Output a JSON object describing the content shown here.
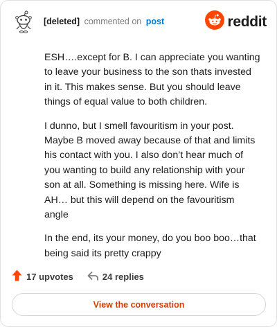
{
  "header": {
    "username": "[deleted]",
    "verb": "commented on",
    "post_link": "post"
  },
  "logo": {
    "wordmark": "reddit",
    "brand_color": "#ff4500"
  },
  "comment": {
    "paragraphs": [
      "ESH….except for B. I can appreciate you wanting to leave your business to the son thats invested in it. This makes sense. But you should leave things of equal value to both children.",
      "I dunno, but I smell favouritism in your post. Maybe B moved away because of that and limits his contact with you. I also don’t hear much of you wanting to build any relationship with your son at all. Something is missing here. Wife is AH… but this will depend on the favouritism angle",
      "In the end, its your money, do you boo boo…that being said its pretty crappy"
    ]
  },
  "footer": {
    "upvotes": "17 upvotes",
    "replies": "24 replies",
    "upvote_color": "#ff4500"
  },
  "cta": {
    "label": "View the conversation",
    "color": "#d93a00"
  },
  "icons": [
    "snoo-avatar-icon",
    "reddit-logo-icon",
    "upvote-arrow-icon",
    "reply-arrow-icon"
  ]
}
